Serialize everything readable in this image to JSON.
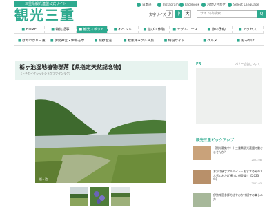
{
  "header": {
    "logo_tagline": "三重県観光連盟公式サイト",
    "logo_text": "観光三重",
    "social": [
      "日本語",
      "Instagram",
      "Facebook",
      "お問い合わせ",
      "Select Language"
    ],
    "font_size_label": "文字サイズ",
    "font_sizes": [
      "小",
      "中",
      "大"
    ],
    "search_placeholder": "サイト内検索",
    "search_button": "Q"
  },
  "nav": {
    "main": [
      {
        "icon": "■",
        "label": "HOME",
        "active": false
      },
      {
        "icon": "■",
        "label": "特集記事",
        "active": false
      },
      {
        "icon": "■",
        "label": "観光スポット",
        "active": true
      },
      {
        "icon": "■",
        "label": "イベント",
        "active": false
      },
      {
        "icon": "■",
        "label": "遊び・体験",
        "active": false
      },
      {
        "icon": "■",
        "label": "モデルコース",
        "active": false
      },
      {
        "icon": "■",
        "label": "旅の予約",
        "active": false
      },
      {
        "icon": "■",
        "label": "アクセス",
        "active": false
      }
    ],
    "sub": [
      {
        "icon": "■",
        "label": "はやわかり三重"
      },
      {
        "icon": "■",
        "label": "伊勢神宮・伊勢志摩"
      },
      {
        "icon": "■",
        "label": "熊野古道"
      },
      {
        "icon": "■",
        "label": "松阪牛★グルメ旅"
      },
      {
        "icon": "■",
        "label": "特設サイト"
      },
      {
        "icon": "■",
        "label": "グルメ"
      },
      {
        "icon": "■",
        "label": "おみやげ"
      }
    ]
  },
  "article": {
    "title": "栃ヶ池湿地植物群落【県指定天然記念物】",
    "subtitle": "（トチガイケシッチショクブツグンラク）",
    "photo_caption": "栃ヶ池"
  },
  "sidebar": {
    "pr_label": "PR",
    "pr_note": "バナー広告について",
    "pickup_title": "観光三重ピックアップ！",
    "pickups": [
      {
        "text": "【観光募集中！】三重県観光連盟で働きませんか？",
        "date": "2022.08"
      },
      {
        "text": "おかげ横丁アルバイト・おすすめ旬の1人気のおかげ横丁に新登場！【2023年】",
        "date": "2022.03"
      },
      {
        "text": "伊勢神宮参拝方法やおかげ横丁の楽しみ方",
        "date": ""
      }
    ]
  },
  "colors": {
    "brand": "#2eaa8f",
    "title_bg": "#e7f3ef"
  }
}
